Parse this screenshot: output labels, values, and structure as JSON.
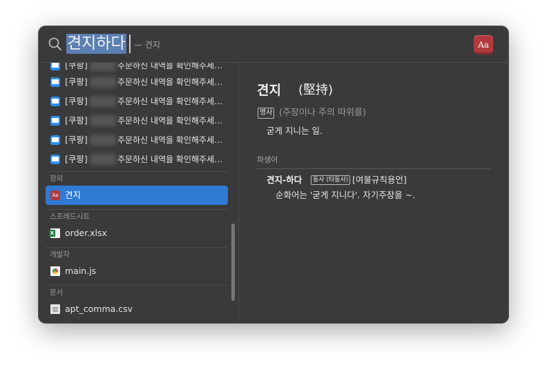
{
  "search": {
    "query": "견지하다",
    "suggestion": "— 견지"
  },
  "app_icon_label": "Aa",
  "results": {
    "mail_rows": [
      {
        "app": "[쿠팡]",
        "subject": "주문하신 내역을 확인해주세…"
      },
      {
        "app": "[쿠팡]",
        "subject": "주문하신 내역을 확인해주세…"
      },
      {
        "app": "[쿠팡]",
        "subject": "주문하신 내역을 확인해주세…"
      },
      {
        "app": "[쿠팡]",
        "subject": "주문하신 내역을 확인해주세…"
      },
      {
        "app": "[쿠팡]",
        "subject": "주문하신 내역을 확인해주세…"
      },
      {
        "app": "[쿠팡]",
        "subject": "주문하신 내역을 확인해주세…"
      }
    ],
    "sections": {
      "definition": {
        "label": "정의",
        "item": "견지",
        "icon": "dictionary-icon"
      },
      "spreadsheet": {
        "label": "스프레드시트",
        "item": "order.xlsx",
        "icon": "excel-file-icon"
      },
      "developer": {
        "label": "개발자",
        "item": "main.js",
        "icon": "chrome-file-icon"
      },
      "documents": {
        "label": "문서",
        "item": "apt_comma.csv",
        "icon": "csv-file-icon"
      }
    }
  },
  "definition": {
    "headword": "견지",
    "hanja": "(堅持)",
    "pos": "명사",
    "note": "(주장이나 주의 따위를)",
    "meaning": "굳게 지니는 일.",
    "derived_label": "파생어",
    "derived": {
      "word": "견지-하다",
      "pos": "동사 (타동사)",
      "tag": "[여불규칙용언]",
      "definition": "순화어는 '굳게 지니다'. 자기주장을 ~."
    }
  },
  "colors": {
    "window_bg": "#3a3a3a",
    "selection": "#2f7ad3",
    "query_highlight": "#5b7fb1",
    "dictionary_red": "#b23a3e",
    "mail_blue": "#2d8ef0"
  }
}
